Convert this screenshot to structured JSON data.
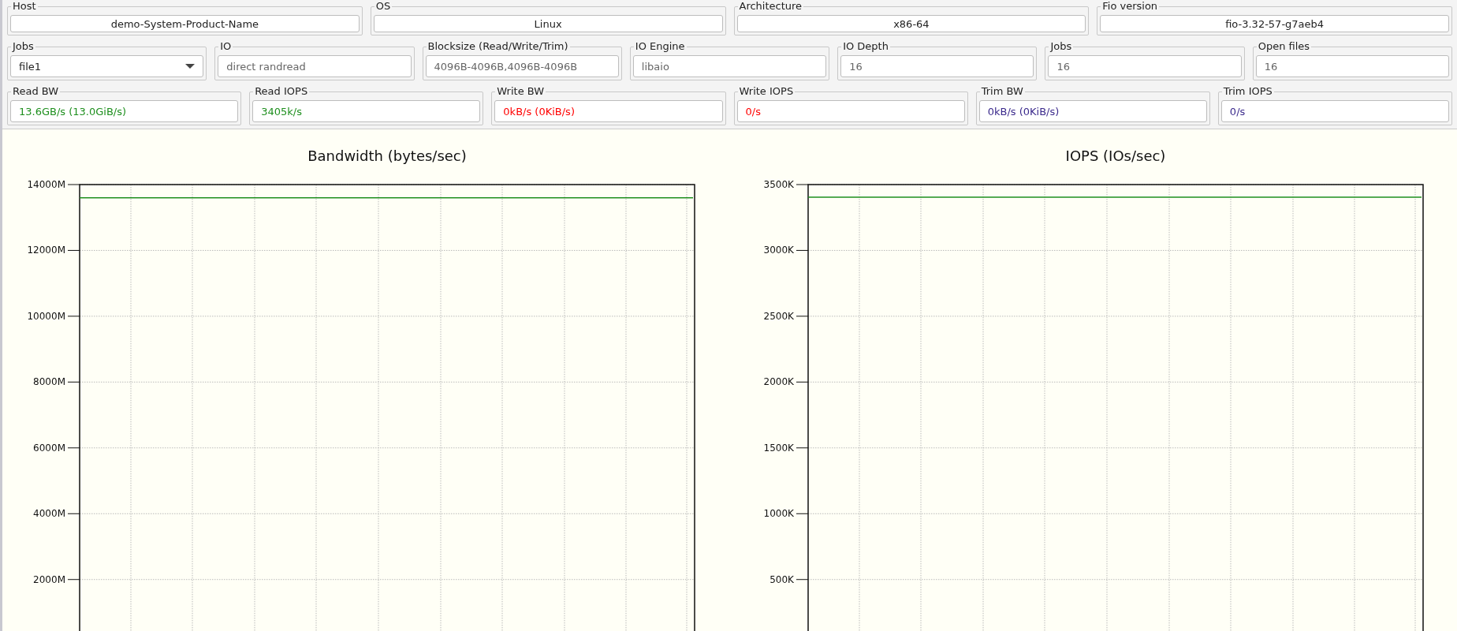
{
  "info": [
    {
      "label": "Host",
      "value": "demo-System-Product-Name"
    },
    {
      "label": "OS",
      "value": "Linux"
    },
    {
      "label": "Architecture",
      "value": "x86-64"
    },
    {
      "label": "Fio version",
      "value": "fio-3.32-57-g7aeb4"
    }
  ],
  "config": [
    {
      "kind": "dropdown",
      "label": "Jobs",
      "value": "file1"
    },
    {
      "kind": "field",
      "label": "IO",
      "value": "direct randread"
    },
    {
      "kind": "field",
      "label": "Blocksize (Read/Write/Trim)",
      "value": "4096B-4096B,4096B-4096B"
    },
    {
      "kind": "field",
      "label": "IO Engine",
      "value": "libaio"
    },
    {
      "kind": "field",
      "label": "IO Depth",
      "value": "16"
    },
    {
      "kind": "field",
      "label": "Jobs",
      "value": "16"
    },
    {
      "kind": "field",
      "label": "Open files",
      "value": "16"
    }
  ],
  "stats": [
    {
      "label": "Read BW",
      "value": "13.6GB/s (13.0GiB/s)",
      "color": "#1e8f1e"
    },
    {
      "label": "Read IOPS",
      "value": "3405k/s",
      "color": "#1e8f1e"
    },
    {
      "label": "Write BW",
      "value": "0kB/s (0KiB/s)",
      "color": "#ff0000"
    },
    {
      "label": "Write IOPS",
      "value": "0/s",
      "color": "#ff0000"
    },
    {
      "label": "Trim BW",
      "value": "0kB/s (0KiB/s)",
      "color": "#3b2a8c"
    },
    {
      "label": "Trim IOPS",
      "value": "0/s",
      "color": "#3b2a8c"
    }
  ],
  "charts": [
    {
      "chart_data": {
        "type": "line",
        "grid": true,
        "title": "Bandwidth (bytes/sec)",
        "ylim": [
          340,
          14000
        ],
        "yticks": [
          {
            "value": 2000,
            "label": "2000M"
          },
          {
            "value": 4000,
            "label": "4000M"
          },
          {
            "value": 6000,
            "label": "6000M"
          },
          {
            "value": 8000,
            "label": "8000M"
          },
          {
            "value": 10000,
            "label": "10000M"
          },
          {
            "value": 12000,
            "label": "12000M"
          },
          {
            "value": 14000,
            "label": "14000M"
          }
        ],
        "series": [
          {
            "color": "#1e8f1e",
            "values": [
              13600,
              13600,
              13600,
              13600,
              13600,
              13600,
              13600,
              13600,
              13600,
              13600,
              13600
            ]
          }
        ]
      }
    },
    {
      "chart_data": {
        "type": "line",
        "grid": true,
        "title": "IOPS (IOs/sec)",
        "ylim": [
          85,
          3500
        ],
        "yticks": [
          {
            "value": 500,
            "label": "500K"
          },
          {
            "value": 1000,
            "label": "1000K"
          },
          {
            "value": 1500,
            "label": "1500K"
          },
          {
            "value": 2000,
            "label": "2000K"
          },
          {
            "value": 2500,
            "label": "2500K"
          },
          {
            "value": 3000,
            "label": "3000K"
          },
          {
            "value": 3500,
            "label": "3500K"
          }
        ],
        "series": [
          {
            "color": "#1e8f1e",
            "values": [
              3405,
              3405,
              3405,
              3405,
              3405,
              3405,
              3405,
              3405,
              3405,
              3405,
              3405
            ]
          }
        ]
      }
    }
  ]
}
